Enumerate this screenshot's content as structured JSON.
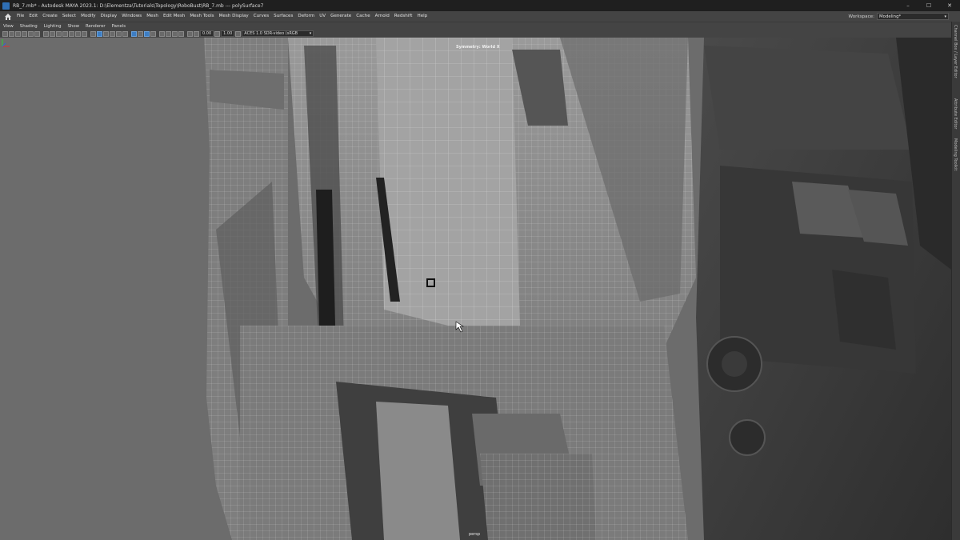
{
  "window": {
    "title": "RB_7.mb* - Autodesk MAYA 2023.1: D:\\Elementza\\Tutorials\\Topology\\RoboBust\\RB_7.mb  ---  polySurface7",
    "controls": [
      "–",
      "☐",
      "✕"
    ]
  },
  "menubar": {
    "items": [
      "File",
      "Edit",
      "Create",
      "Select",
      "Modify",
      "Display",
      "Windows",
      "Mesh",
      "Edit Mesh",
      "Mesh Tools",
      "Mesh Display",
      "Curves",
      "Surfaces",
      "Deform",
      "UV",
      "Generate",
      "Cache",
      "Arnold",
      "Redshift",
      "Help"
    ],
    "workspace_label": "Workspace:",
    "workspace_value": "Modeling*"
  },
  "panel_menu": {
    "items": [
      "View",
      "Shading",
      "Lighting",
      "Show",
      "Renderer",
      "Panels"
    ]
  },
  "toolbar": {
    "exposure_value": "0.00",
    "gamma_value": "1.00",
    "color_space": "ACES 1.0 SDR-video (sRGB"
  },
  "side_tabs": [
    "Channel Box / Layer Editor",
    "Attribute Editor",
    "Modeling Toolkit"
  ],
  "viewport": {
    "symmetry_label": "Symmetry:  World X",
    "camera_label": "persp"
  },
  "colors": {
    "accent_blue": "#3d7ec4",
    "viewport_bg": "#6c6c6c",
    "menubar_bg": "#444444",
    "titlebar_bg": "#1f1f1f"
  }
}
